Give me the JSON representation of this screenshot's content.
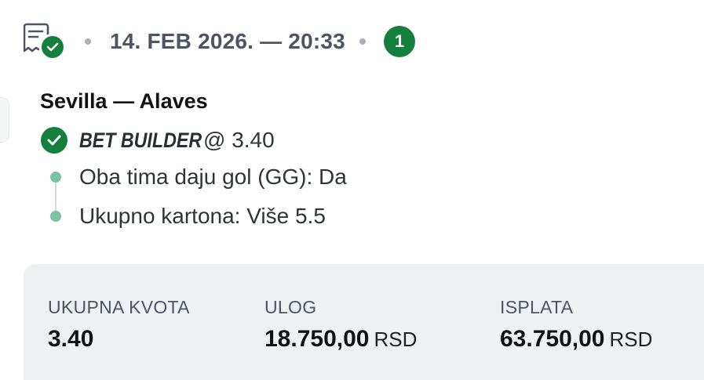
{
  "header": {
    "date_time": "14. FEB 2026. — 20:33",
    "selection_count": "1",
    "icon": "ticket-check-icon"
  },
  "match": {
    "title": "Sevilla — Alaves"
  },
  "bet": {
    "type": "BET BUILDER",
    "odds": "@ 3.40",
    "status_icon": "check-circle-icon",
    "selections": [
      {
        "label": "Oba tima daju gol (GG): Da"
      },
      {
        "label": "Ukupno kartona: Više 5.5"
      }
    ]
  },
  "summary": {
    "total_odds_label": "UKUPNA KVOTA",
    "total_odds_value": "3.40",
    "stake_label": "ULOG",
    "stake_value": "18.750,00",
    "stake_currency": "RSD",
    "payout_label": "ISPLATA",
    "payout_value": "63.750,00",
    "payout_currency": "RSD"
  },
  "colors": {
    "success_green": "#15803d",
    "selection_dot": "#7cc4a0",
    "summary_bg": "#eff0f2"
  }
}
